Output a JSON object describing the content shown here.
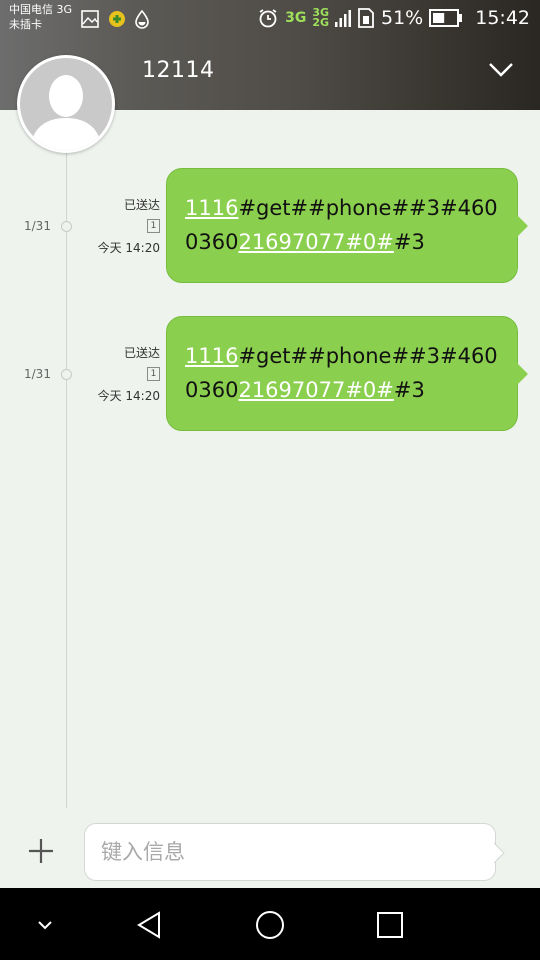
{
  "status_bar": {
    "carrier_line1": "中国电信 3G",
    "carrier_line2": "未插卡",
    "network_top": "3G",
    "network_stack_top": "3G",
    "network_stack_bottom": "2G",
    "battery_percent": "51%",
    "battery_level": 0.51,
    "time": "15:42",
    "icons": [
      "image-icon",
      "app-badge-icon",
      "droplet-icon",
      "alarm-icon",
      "signal-icon",
      "sim-icon",
      "battery-icon"
    ]
  },
  "header": {
    "contact": "12114"
  },
  "messages": [
    {
      "date": "1/31",
      "status": "已送达",
      "sim": "1",
      "time": "今天 14:20",
      "parts": [
        {
          "text": "1116",
          "link": true
        },
        {
          "text": "#get##phone##3#4600360",
          "link": false
        },
        {
          "text": "21697077#0#",
          "link": true
        },
        {
          "text": "#3",
          "link": false
        }
      ]
    },
    {
      "date": "1/31",
      "status": "已送达",
      "sim": "1",
      "time": "今天 14:20",
      "parts": [
        {
          "text": "1116",
          "link": true
        },
        {
          "text": "#get##phone##3#4600360",
          "link": false
        },
        {
          "text": "21697077#0#",
          "link": true
        },
        {
          "text": "#3",
          "link": false
        }
      ]
    }
  ],
  "compose": {
    "placeholder": "键入信息"
  },
  "colors": {
    "bubble": "#8bcf4f",
    "background": "#eef3ee",
    "link": "#ffffff"
  }
}
